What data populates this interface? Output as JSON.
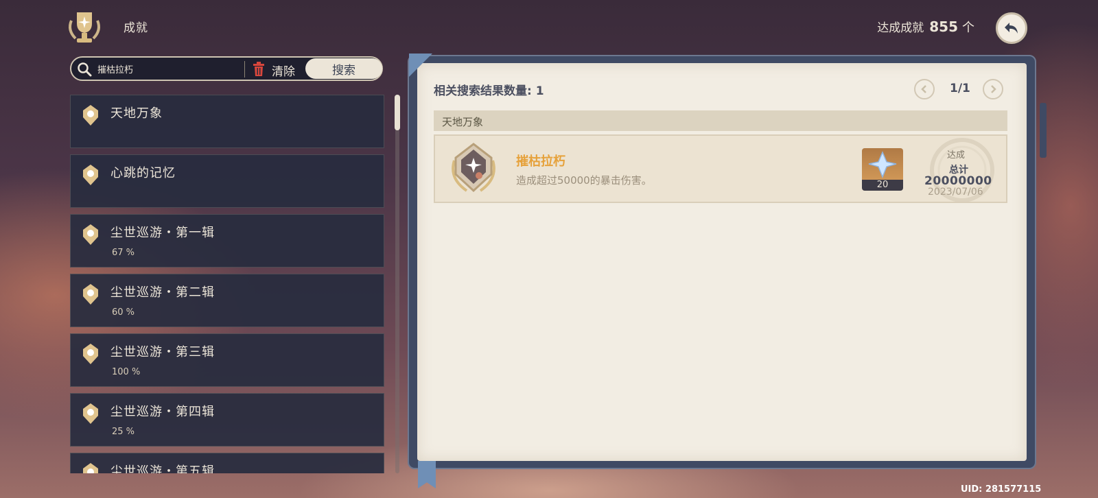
{
  "header": {
    "title": "成就",
    "achieved_label": "达成成就",
    "achieved_count": "855",
    "achieved_unit": "个"
  },
  "search": {
    "query": "摧枯拉朽",
    "clear_label": "清除",
    "search_label": "搜索"
  },
  "categories": [
    {
      "label": "天地万象",
      "pct": ""
    },
    {
      "label": "心跳的记忆",
      "pct": ""
    },
    {
      "label": "尘世巡游・第一辑",
      "pct": "67 %"
    },
    {
      "label": "尘世巡游・第二辑",
      "pct": "60 %"
    },
    {
      "label": "尘世巡游・第三辑",
      "pct": "100 %"
    },
    {
      "label": "尘世巡游・第四辑",
      "pct": "25 %"
    },
    {
      "label": "尘世巡游・第五辑",
      "pct": ""
    }
  ],
  "results": {
    "count_label": "相关搜索结果数量: 1",
    "page_indicator": "1/1",
    "section_title": "天地万象",
    "achievement": {
      "name": "摧枯拉朽",
      "description": "造成超过50000的暴击伤害。",
      "reward_qty": "20",
      "done_label": "达成",
      "done_total_label": "总计",
      "done_value": "20000000",
      "done_date": "2023/07/06"
    }
  },
  "footer": {
    "uid": "UID: 281577115"
  },
  "colors": {
    "accent_gold": "#e6a13a",
    "panel_dark": "#282c3e",
    "page_paper": "#f2ede3"
  }
}
